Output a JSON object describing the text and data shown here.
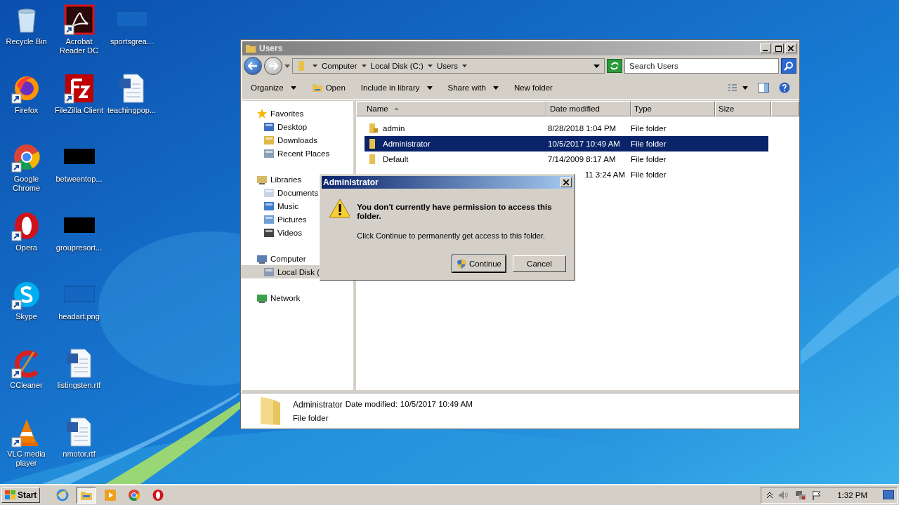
{
  "desktop_icons": [
    {
      "label": "Recycle Bin",
      "kind": "recycle",
      "shortcut": false
    },
    {
      "label": "Firefox",
      "kind": "firefox",
      "shortcut": true
    },
    {
      "label": "Google Chrome",
      "kind": "chrome",
      "shortcut": true
    },
    {
      "label": "Opera",
      "kind": "opera",
      "shortcut": true
    },
    {
      "label": "Skype",
      "kind": "skype",
      "shortcut": true
    },
    {
      "label": "CCleaner",
      "kind": "ccleaner",
      "shortcut": true
    },
    {
      "label": "VLC media player",
      "kind": "vlc",
      "shortcut": true
    },
    {
      "label": "Acrobat Reader DC",
      "kind": "acrobat",
      "shortcut": true
    },
    {
      "label": "FileZilla Client",
      "kind": "filezilla",
      "shortcut": true
    },
    {
      "label": "betweentop...",
      "kind": "thumb_dark",
      "shortcut": false
    },
    {
      "label": "groupresort...",
      "kind": "thumb_dark",
      "shortcut": false
    },
    {
      "label": "headart.png",
      "kind": "thumb_blank",
      "shortcut": false
    },
    {
      "label": "listingsten.rtf",
      "kind": "word",
      "shortcut": false
    },
    {
      "label": "nmotor.rtf",
      "kind": "word",
      "shortcut": false
    },
    {
      "label": "sportsgrea...",
      "kind": "thumb_blank",
      "shortcut": false
    },
    {
      "label": "teachingpop...",
      "kind": "word",
      "shortcut": false
    }
  ],
  "explorer": {
    "title": "Users",
    "breadcrumb": [
      "Computer",
      "Local Disk (C:)",
      "Users"
    ],
    "search": {
      "placeholder": "Search Users"
    },
    "toolbar": [
      {
        "label": "Organize",
        "dropdown": true,
        "icon": false
      },
      {
        "label": "Open",
        "dropdown": false,
        "icon": true
      },
      {
        "label": "Include in library",
        "dropdown": true,
        "icon": false
      },
      {
        "label": "Share with",
        "dropdown": true,
        "icon": false
      },
      {
        "label": "New folder",
        "dropdown": false,
        "icon": false
      }
    ],
    "nav": [
      {
        "label": "Favorites",
        "kind": "star",
        "selected": false,
        "children": [
          {
            "label": "Desktop",
            "kind": "desktop",
            "selected": false
          },
          {
            "label": "Downloads",
            "kind": "downloads",
            "selected": false
          },
          {
            "label": "Recent Places",
            "kind": "recent",
            "selected": false
          }
        ]
      },
      {
        "label": "Libraries",
        "kind": "libraries",
        "selected": false,
        "children": [
          {
            "label": "Documents",
            "kind": "documents",
            "selected": false
          },
          {
            "label": "Music",
            "kind": "music",
            "selected": false
          },
          {
            "label": "Pictures",
            "kind": "pictures",
            "selected": false
          },
          {
            "label": "Videos",
            "kind": "videos",
            "selected": false
          }
        ]
      },
      {
        "label": "Computer",
        "kind": "computer",
        "selected": false,
        "children": [
          {
            "label": "Local Disk (",
            "kind": "disk",
            "selected": true
          }
        ]
      },
      {
        "label": "Network",
        "kind": "network",
        "selected": false
      }
    ],
    "columns": [
      {
        "label": "Name",
        "sorted": true
      },
      {
        "label": "Date modified",
        "sorted": false
      },
      {
        "label": "Type",
        "sorted": false
      },
      {
        "label": "Size",
        "sorted": false
      }
    ],
    "rows": [
      {
        "name": "admin",
        "date": "8/28/2018 1:04 PM",
        "type": "File folder",
        "locked": true,
        "selected": false
      },
      {
        "name": "Administrator",
        "date": "10/5/2017 10:49 AM",
        "type": "File folder",
        "locked": false,
        "selected": true
      },
      {
        "name": "Default",
        "date": "7/14/2009 8:17 AM",
        "type": "File folder",
        "locked": false,
        "selected": false
      },
      {
        "date": "11 3:24 AM",
        "type": "File folder",
        "selected": false
      }
    ],
    "details": {
      "name": "Administrator",
      "date_label": "Date modified:",
      "date": "10/5/2017 10:49 AM",
      "type": "File folder"
    }
  },
  "dialog": {
    "title": "Administrator",
    "heading": "You don't currently have permission to access this folder.",
    "message": "Click Continue to permanently get access to this folder.",
    "buttons": [
      {
        "label": "Continue",
        "shield": true,
        "default": true
      },
      {
        "label": "Cancel",
        "shield": false,
        "default": false
      }
    ]
  },
  "taskbar": {
    "start": "Start",
    "apps": [
      {
        "kind": "ie",
        "active": false
      },
      {
        "kind": "explorer",
        "active": true
      },
      {
        "kind": "media",
        "active": false
      },
      {
        "kind": "chrome",
        "active": false
      },
      {
        "kind": "opera",
        "active": false
      }
    ],
    "clock": "1:32 PM"
  }
}
